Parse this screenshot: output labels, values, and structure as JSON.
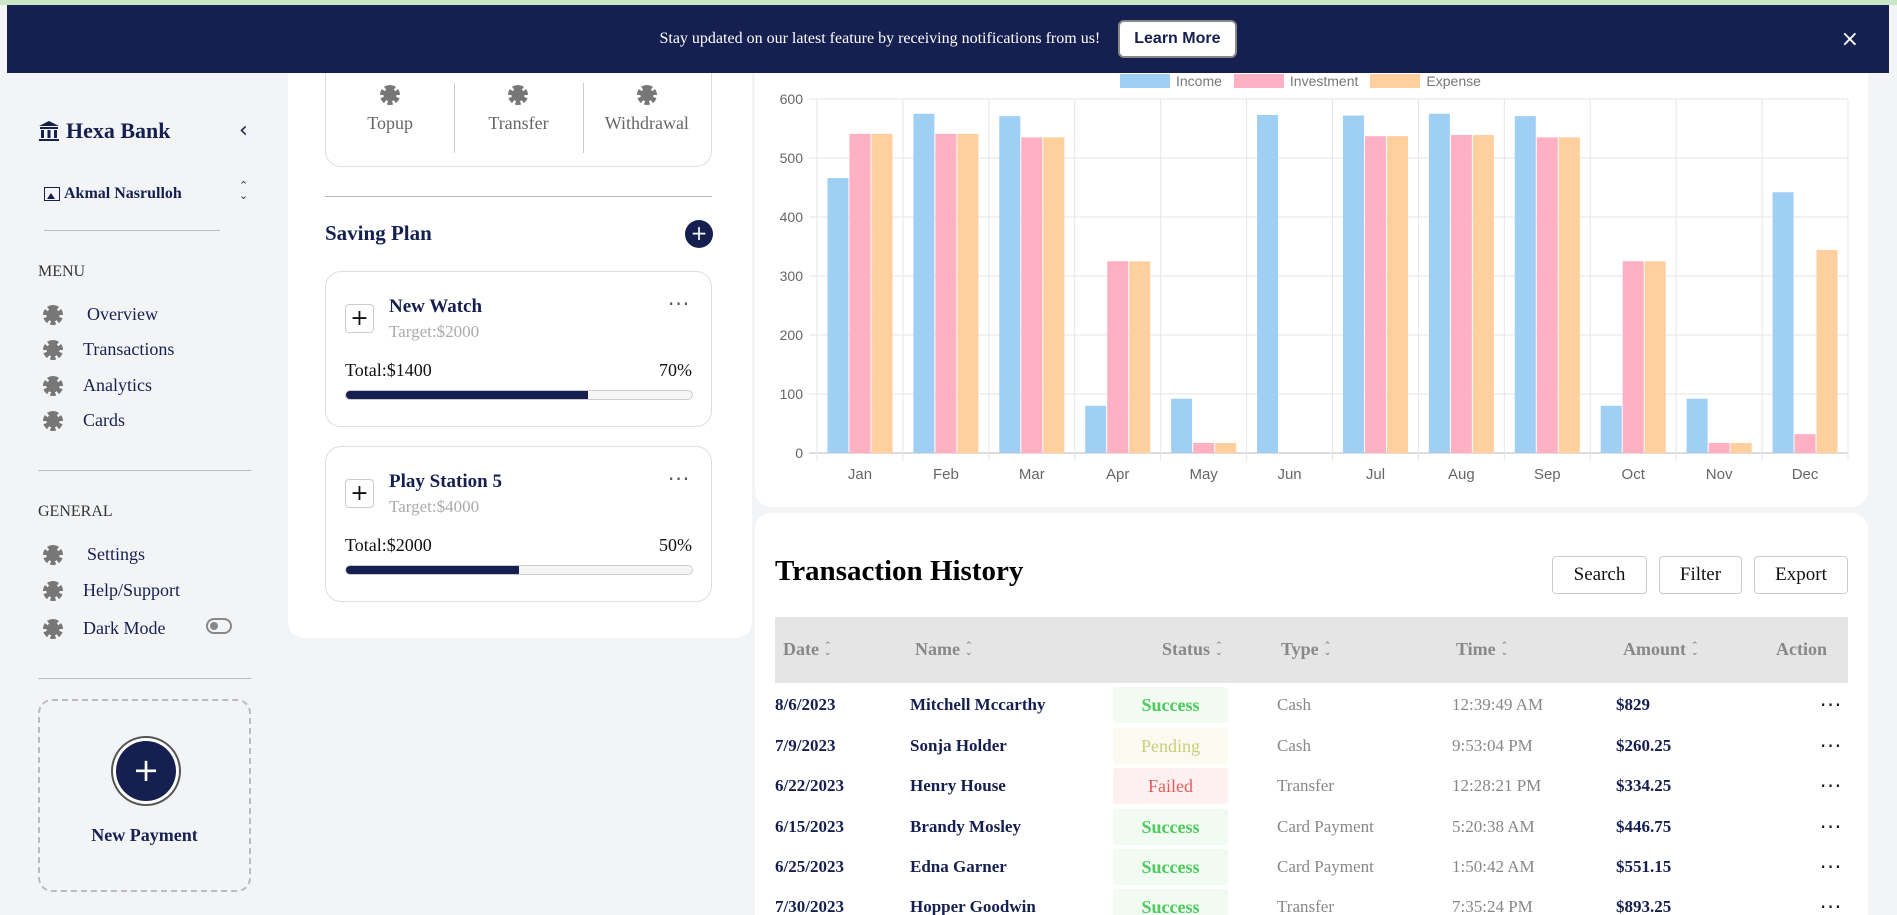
{
  "banner": {
    "text": "Stay updated on our latest feature by receiving notifications from us!",
    "button_label": "Learn More",
    "close_label": "×"
  },
  "sidebar": {
    "brand": "Hexa Bank",
    "collapse_icon": "‹",
    "user_name": "Akmal Nasrulloh",
    "menu_label": "MENU",
    "menu_items": [
      {
        "label": "Overview",
        "icon": "gear-icon"
      },
      {
        "label": "Transactions",
        "icon": "gear-icon"
      },
      {
        "label": "Analytics",
        "icon": "gear-icon"
      },
      {
        "label": "Cards",
        "icon": "gear-icon"
      }
    ],
    "general_label": "GENERAL",
    "general_items": [
      {
        "label": "Settings",
        "icon": "gear-icon"
      },
      {
        "label": "Help/Support",
        "icon": "gear-icon"
      },
      {
        "label": "Dark Mode",
        "icon": "gear-icon"
      }
    ],
    "dark_mode_on": false,
    "new_payment_label": "New Payment"
  },
  "quick_actions": [
    "Topup",
    "Transfer",
    "Withdrawal"
  ],
  "saving_plan": {
    "title": "Saving Plan",
    "plans": [
      {
        "name": "New Watch",
        "target": "Target:$2000",
        "total": "Total:$1400",
        "percent_label": "70%",
        "progress": 0.7
      },
      {
        "name": "Play Station 5",
        "target": "Target:$4000",
        "total": "Total:$2000",
        "percent_label": "50%",
        "progress": 0.5
      }
    ]
  },
  "chart_data": {
    "type": "bar",
    "categories": [
      "Jan",
      "Feb",
      "Mar",
      "Apr",
      "May",
      "Jun",
      "Jul",
      "Aug",
      "Sep",
      "Oct",
      "Nov",
      "Dec"
    ],
    "series": [
      {
        "name": "Income",
        "color": "#9fcff3",
        "values": [
          466,
          575,
          571,
          80,
          92,
          573,
          572,
          575,
          571,
          80,
          92,
          442
        ]
      },
      {
        "name": "Investment",
        "color": "#ffb0c3",
        "values": [
          541,
          541,
          535,
          325,
          17,
          0,
          537,
          539,
          535,
          325,
          17,
          32
        ]
      },
      {
        "name": "Expense",
        "color": "#ffcf9d",
        "values": [
          541,
          541,
          535,
          325,
          17,
          0,
          537,
          539,
          535,
          325,
          17,
          344
        ]
      }
    ],
    "ylim": [
      0,
      600
    ],
    "yticks": [
      0,
      100,
      200,
      300,
      400,
      500,
      600
    ],
    "grid": true,
    "legend": "top"
  },
  "transactions": {
    "title": "Transaction History",
    "buttons": {
      "search": "Search",
      "filter": "Filter",
      "export": "Export"
    },
    "columns": [
      "Date",
      "Name",
      "Status",
      "Type",
      "Time",
      "Amount",
      "Action"
    ],
    "rows": [
      {
        "date": "8/6/2023",
        "name": "Mitchell Mccarthy",
        "status": "Success",
        "type": "Cash",
        "time": "12:39:49 AM",
        "amount": "$829"
      },
      {
        "date": "7/9/2023",
        "name": "Sonja Holder",
        "status": "Pending",
        "type": "Cash",
        "time": "9:53:04 PM",
        "amount": "$260.25"
      },
      {
        "date": "6/22/2023",
        "name": "Henry House",
        "status": "Failed",
        "type": "Transfer",
        "time": "12:28:21 PM",
        "amount": "$334.25"
      },
      {
        "date": "6/15/2023",
        "name": "Brandy Mosley",
        "status": "Success",
        "type": "Card Payment",
        "time": "5:20:38 AM",
        "amount": "$446.75"
      },
      {
        "date": "6/25/2023",
        "name": "Edna Garner",
        "status": "Success",
        "type": "Card Payment",
        "time": "1:50:42 AM",
        "amount": "$551.15"
      },
      {
        "date": "7/30/2023",
        "name": "Hopper Goodwin",
        "status": "Success",
        "type": "Transfer",
        "time": "7:35:24 PM",
        "amount": "$893.25"
      }
    ]
  }
}
